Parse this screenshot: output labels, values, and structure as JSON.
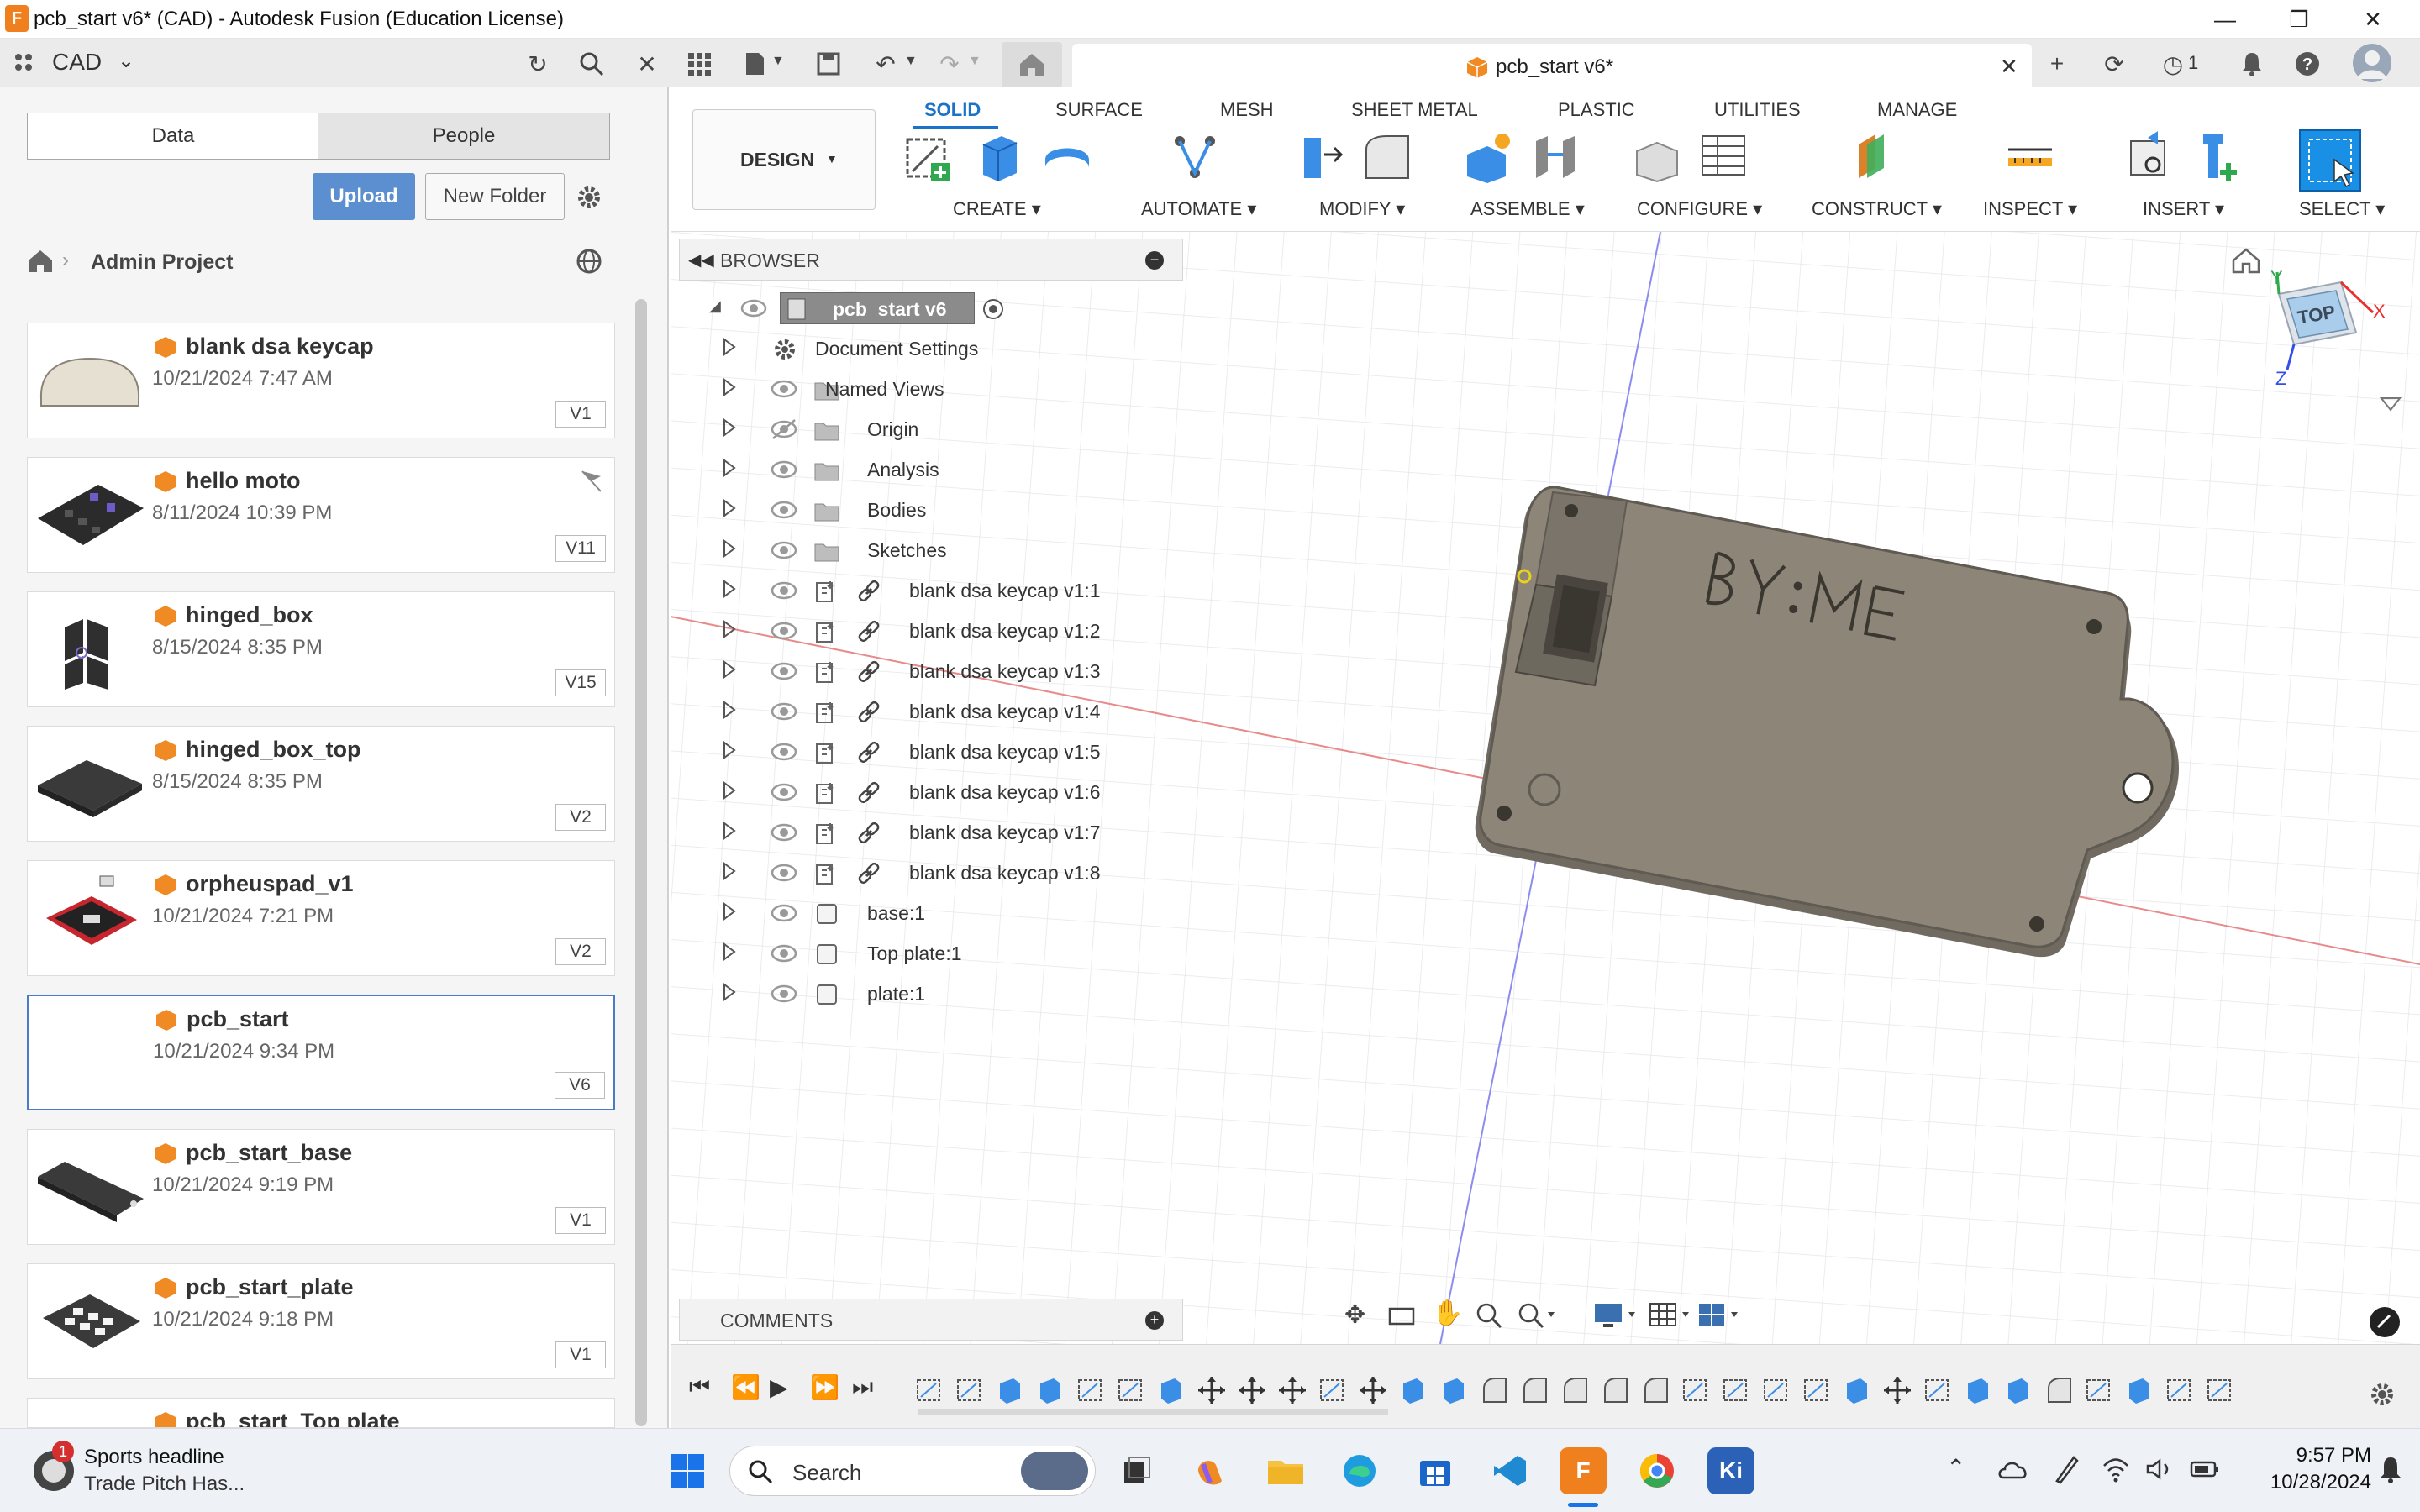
{
  "window": {
    "title": "pcb_start v6* (CAD) - Autodesk Fusion (Education License)",
    "app_icon_letter": "F"
  },
  "app_toolbar": {
    "workspace": "CAD",
    "doc_tab_label": "pcb_start v6*",
    "job_count": "1"
  },
  "data_panel": {
    "tabs": [
      "Data",
      "People"
    ],
    "upload_label": "Upload",
    "new_folder_label": "New Folder",
    "breadcrumb": "Admin Project",
    "files": [
      {
        "name": "blank dsa keycap",
        "date": "10/21/2024 7:47 AM",
        "version": "V1"
      },
      {
        "name": "hello moto",
        "date": "8/11/2024 10:39 PM",
        "version": "V11"
      },
      {
        "name": "hinged_box",
        "date": "8/15/2024 8:35 PM",
        "version": "V15"
      },
      {
        "name": "hinged_box_top",
        "date": "8/15/2024 8:35 PM",
        "version": "V2"
      },
      {
        "name": "orpheuspad_v1",
        "date": "10/21/2024 7:21 PM",
        "version": "V2"
      },
      {
        "name": "pcb_start",
        "date": "10/21/2024 9:34 PM",
        "version": "V6"
      },
      {
        "name": "pcb_start_base",
        "date": "10/21/2024 9:19 PM",
        "version": "V1"
      },
      {
        "name": "pcb_start_plate",
        "date": "10/21/2024 9:18 PM",
        "version": "V1"
      },
      {
        "name": "pcb_start_Top plate",
        "date": "",
        "version": ""
      }
    ]
  },
  "ribbon": {
    "design_label": "DESIGN",
    "tabs": [
      "SOLID",
      "SURFACE",
      "MESH",
      "SHEET METAL",
      "PLASTIC",
      "UTILITIES",
      "MANAGE"
    ],
    "active_tab": "SOLID",
    "groups": [
      "CREATE",
      "AUTOMATE",
      "MODIFY",
      "ASSEMBLE",
      "CONFIGURE",
      "CONSTRUCT",
      "INSPECT",
      "INSERT",
      "SELECT"
    ]
  },
  "browser": {
    "header": "BROWSER",
    "root": "pcb_start v6",
    "items": [
      {
        "label": "Document Settings",
        "icon": "gear-icon"
      },
      {
        "label": "Named Views",
        "icon": "folder-icon"
      },
      {
        "label": "Origin",
        "icon": "folder-icon"
      },
      {
        "label": "Analysis",
        "icon": "folder-icon"
      },
      {
        "label": "Bodies",
        "icon": "folder-icon"
      },
      {
        "label": "Sketches",
        "icon": "folder-icon"
      },
      {
        "label": "blank dsa keycap v1:1",
        "icon": "link-icon"
      },
      {
        "label": "blank dsa keycap v1:2",
        "icon": "link-icon"
      },
      {
        "label": "blank dsa keycap v1:3",
        "icon": "link-icon"
      },
      {
        "label": "blank dsa keycap v1:4",
        "icon": "link-icon"
      },
      {
        "label": "blank dsa keycap v1:5",
        "icon": "link-icon"
      },
      {
        "label": "blank dsa keycap v1:6",
        "icon": "link-icon"
      },
      {
        "label": "blank dsa keycap v1:7",
        "icon": "link-icon"
      },
      {
        "label": "blank dsa keycap v1:8",
        "icon": "link-icon"
      },
      {
        "label": "base:1",
        "icon": "component-icon"
      },
      {
        "label": "Top plate:1",
        "icon": "component-icon"
      },
      {
        "label": "plate:1",
        "icon": "component-icon"
      }
    ]
  },
  "viewport": {
    "viewcube_face": "TOP",
    "axis_x": "X",
    "axis_y": "Y",
    "axis_z": "Z",
    "engraving_text": "BY: ME"
  },
  "comments_label": "COMMENTS",
  "taskbar": {
    "news_title": "Sports headline",
    "news_sub": "Trade Pitch Has...",
    "news_badge": "1",
    "search_label": "Search",
    "time": "9:57 PM",
    "date": "10/28/2024"
  },
  "colors": {
    "accent": "#1a73c8",
    "upload": "#5b8fd0",
    "model": "#8c8578",
    "fusion_orange": "#f0801e"
  }
}
